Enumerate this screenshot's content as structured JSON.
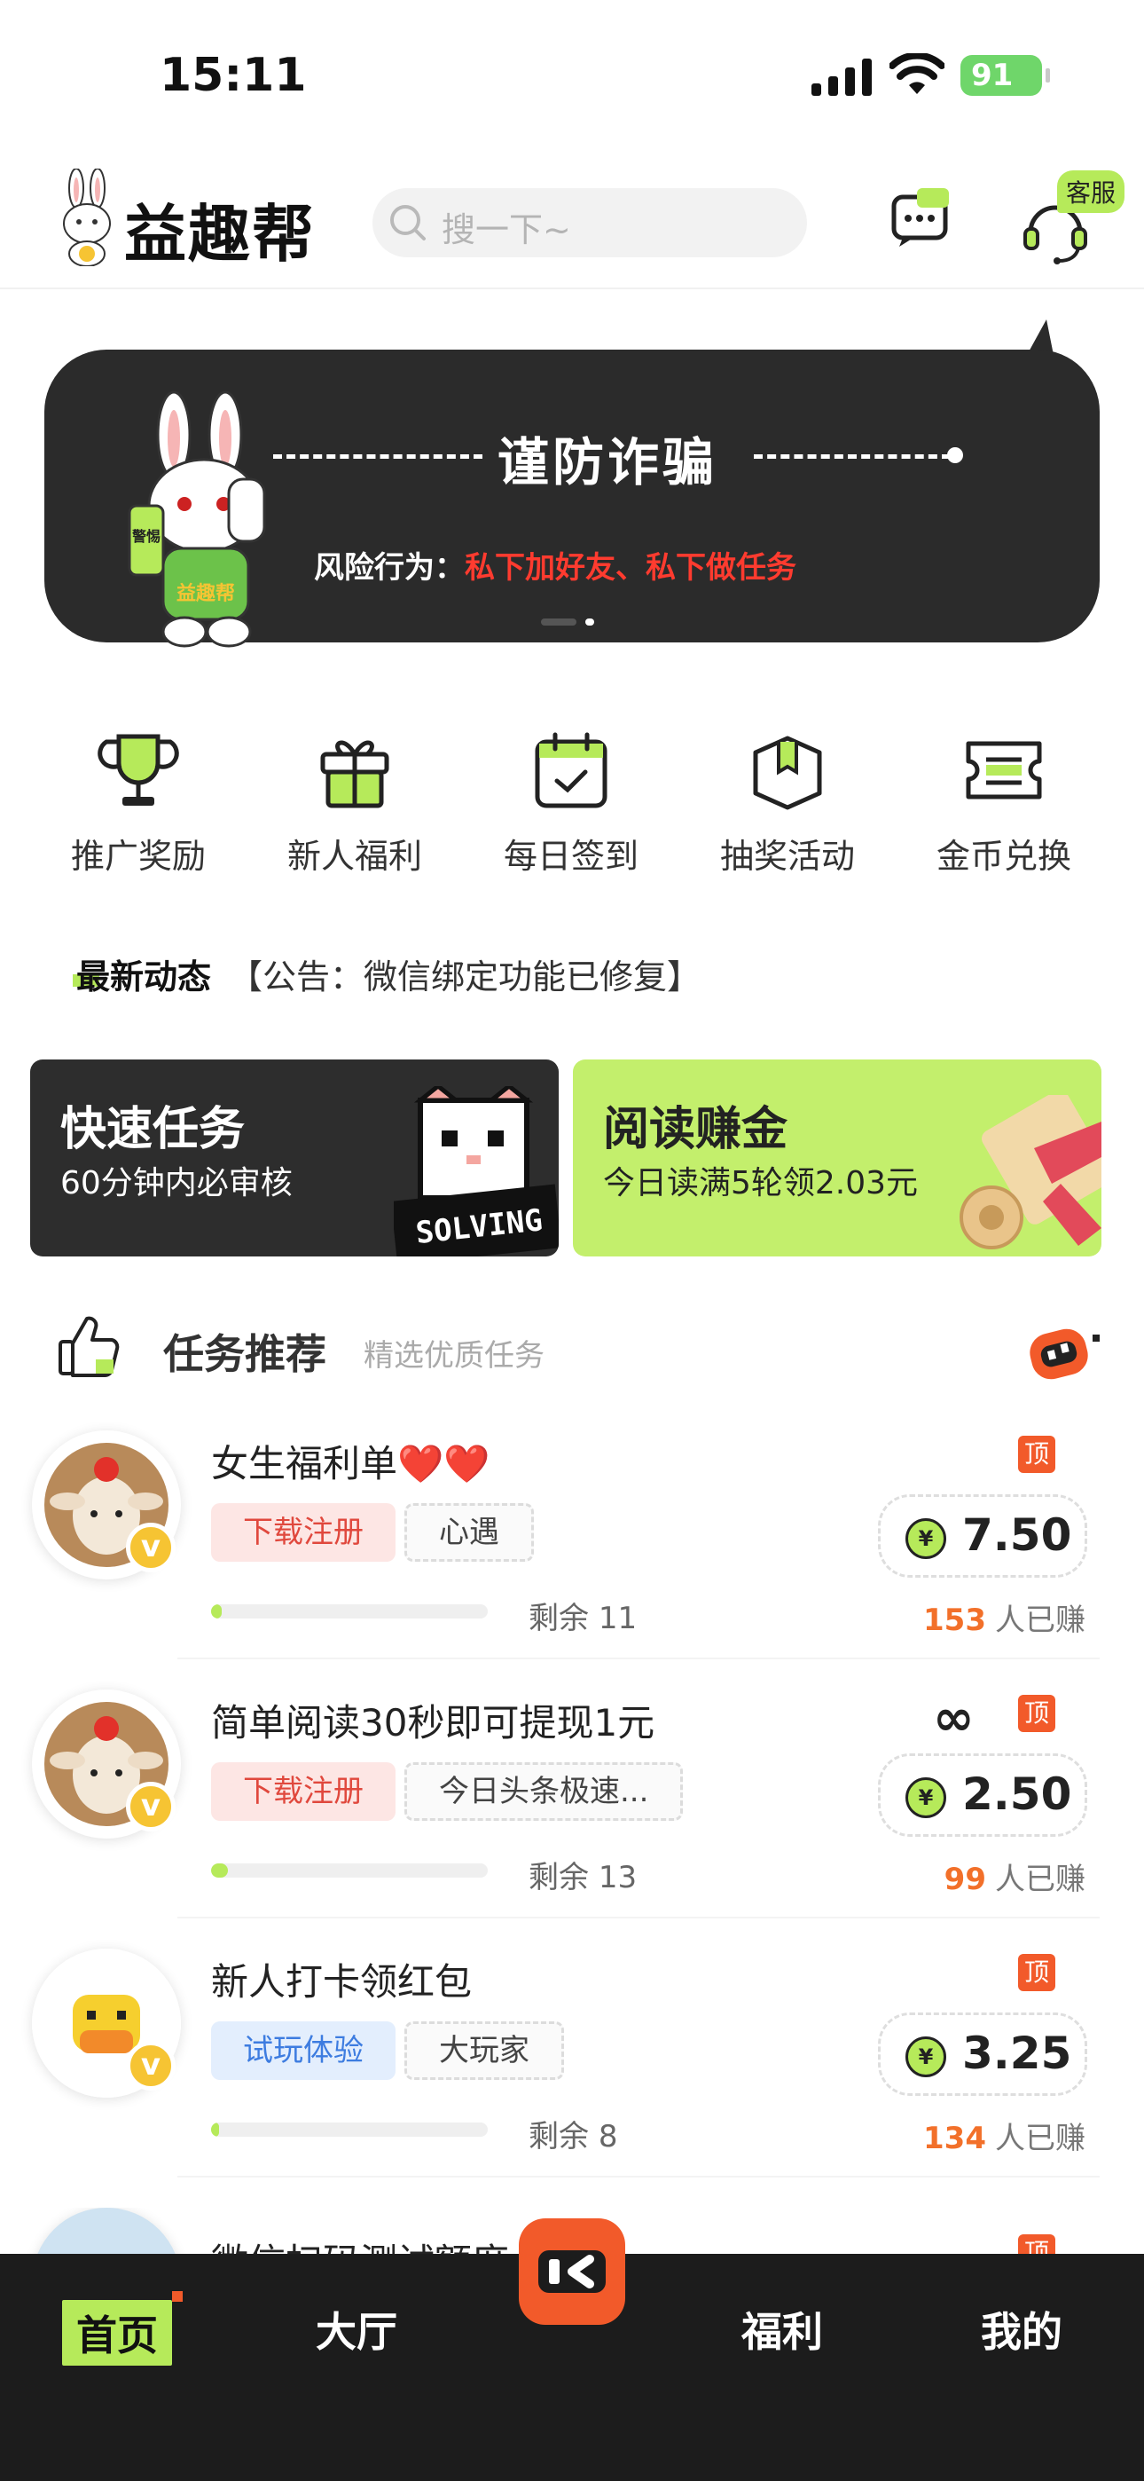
{
  "status_bar": {
    "time": "15:11",
    "battery": "91"
  },
  "header": {
    "brand": "益趣帮",
    "search_placeholder": "搜一下~",
    "cs_badge": "客服"
  },
  "banner": {
    "title": "谨防诈骗",
    "risk_label": "风险行为：",
    "risk_text": "私下加好友、私下做任务",
    "mascot_phone_text": "警惕",
    "mascot_shirt_text": "益趣帮"
  },
  "menu": [
    {
      "label": "推广奖励",
      "icon": "trophy-icon"
    },
    {
      "label": "新人福利",
      "icon": "gift-icon"
    },
    {
      "label": "每日签到",
      "icon": "calendar-check-icon"
    },
    {
      "label": "抽奖活动",
      "icon": "box-icon"
    },
    {
      "label": "金币兑换",
      "icon": "ticket-icon"
    }
  ],
  "news": {
    "head": "最新动态",
    "text": "【公告：微信绑定功能已修复】"
  },
  "cards": {
    "quick": {
      "title": "快速任务",
      "subtitle": "60分钟内必审核",
      "art_text": "SOLVING"
    },
    "read": {
      "title": "阅读赚金",
      "subtitle": "今日读满5轮领2.03元"
    }
  },
  "section": {
    "title": "任务推荐",
    "subtitle": "精选优质任务"
  },
  "tasks": [
    {
      "name": "女生福利单❤️❤️",
      "tag1": "下载注册",
      "tag2": "心遇",
      "remain_label": "剩余",
      "remain": "11",
      "progress": 0.04,
      "price": "7.50",
      "earned": "153",
      "earned_label": "人已赚",
      "top": "顶",
      "infinite": false
    },
    {
      "name": "简单阅读30秒即可提现1元",
      "tag1": "下载注册",
      "tag2": "今日头条极速...",
      "remain_label": "剩余",
      "remain": "13",
      "progress": 0.06,
      "price": "2.50",
      "earned": "99",
      "earned_label": "人已赚",
      "top": "顶",
      "infinite": true,
      "infinite_symbol": "∞"
    },
    {
      "name": "新人打卡领红包",
      "tag1": "试玩体验",
      "tag2": "大玩家",
      "remain_label": "剩余",
      "remain": "8",
      "progress": 0.03,
      "price": "3.25",
      "earned": "134",
      "earned_label": "人已赚",
      "top": "顶",
      "infinite": false
    }
  ],
  "partial_task": {
    "name": "微信扫码测试额度",
    "top": "顶"
  },
  "vbadge": "v",
  "yen": "¥",
  "tabbar": {
    "home": "首页",
    "hall": "大厅",
    "welfare": "福利",
    "mine": "我的"
  },
  "colors": {
    "accent_green": "#b6ea5a",
    "accent_orange": "#f25a2a",
    "dark": "#2b2b2b",
    "risk_red": "#ff3b2f"
  }
}
